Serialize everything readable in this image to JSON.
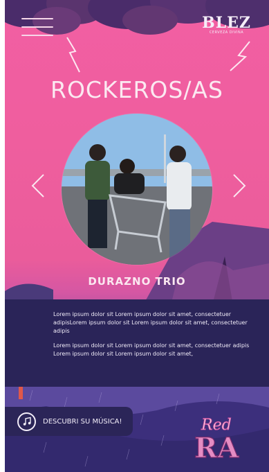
{
  "header": {
    "menu_icon": "hamburger-icon",
    "brand": {
      "logo": "BLEZ",
      "tagline": "CERVEZA DIVINA"
    }
  },
  "hero": {
    "title": "ROCKEROS/AS",
    "band_name": "DURAZNO TRIO",
    "prev_icon": "chevron-left-icon",
    "next_icon": "chevron-right-icon"
  },
  "info": {
    "paragraphs": [
      "Lorem ipsum dolor sit Lorem ipsum dolor sit amet, consectetuer adipisLorem ipsum dolor sit Lorem ipsum dolor sit amet, consectetuer adipis",
      "Lorem ipsum dolor sit Lorem ipsum dolor sit amet, consectetuer adipis",
      "Lorem ipsum dolor sit Lorem ipsum dolor sit amet,"
    ]
  },
  "cta": {
    "label": "DESCUBRI SU MÚSICA!",
    "icon": "music-note-icon"
  },
  "footer_logo": {
    "line1": "Red",
    "line2": "RA"
  },
  "colors": {
    "pink": "#ef5e9e",
    "purple_dark": "#2a2458",
    "text_light": "#f1ecf8"
  }
}
